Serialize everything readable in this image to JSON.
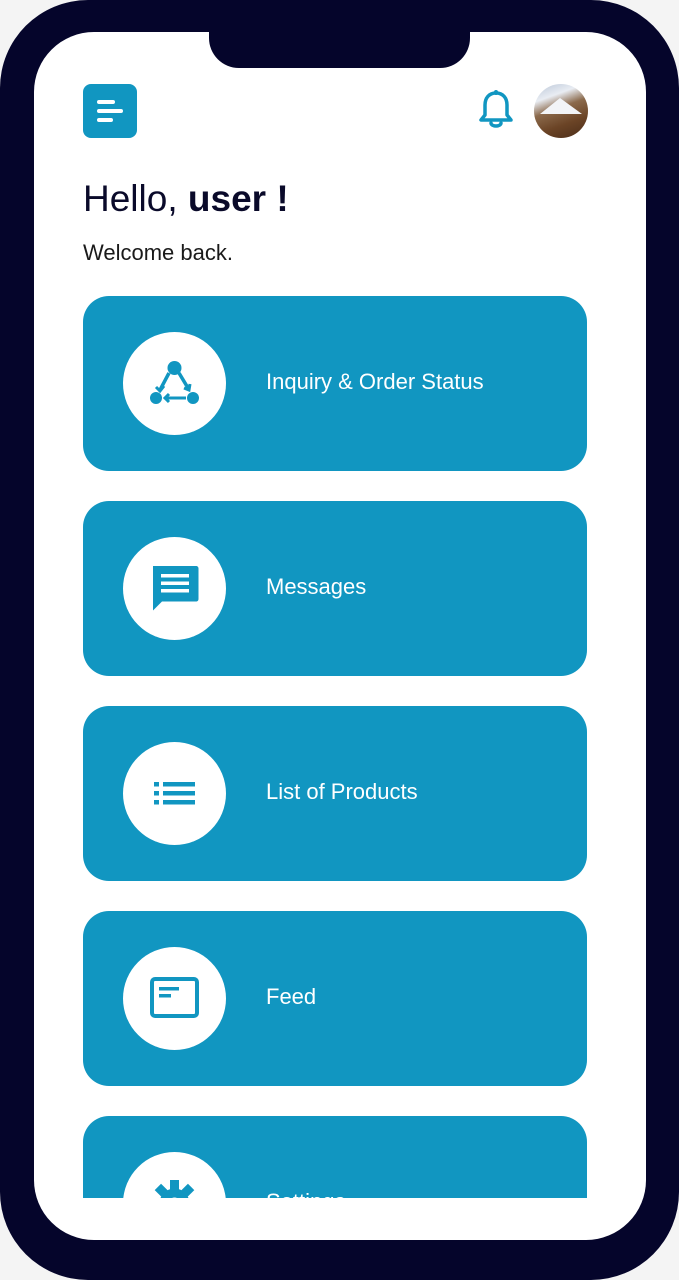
{
  "greeting": {
    "prefix": "Hello, ",
    "name": "user !",
    "subtitle": "Welcome back."
  },
  "header": {
    "menu_icon": "menu-icon",
    "notification_icon": "bell-icon",
    "avatar_icon": "avatar"
  },
  "menu": {
    "items": [
      {
        "label": "Inquiry & Order Status",
        "icon": "workflow-icon"
      },
      {
        "label": "Messages",
        "icon": "chat-icon"
      },
      {
        "label": "List of Products",
        "icon": "list-icon"
      },
      {
        "label": "Feed",
        "icon": "feed-icon"
      },
      {
        "label": "Settings",
        "icon": "gear-icon"
      }
    ]
  },
  "colors": {
    "accent": "#1196c1",
    "frame": "#05052b",
    "background": "#ffffff"
  }
}
